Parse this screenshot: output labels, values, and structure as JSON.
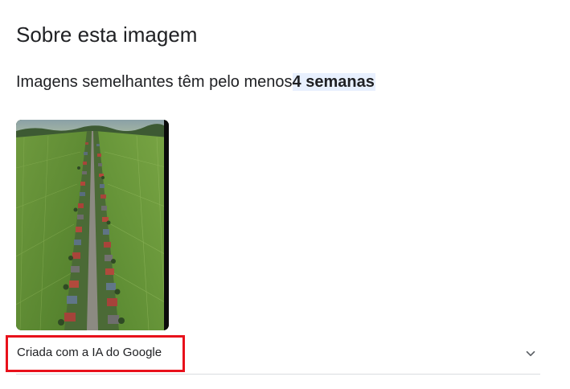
{
  "section": {
    "title": "Sobre esta imagem",
    "age_prefix": "Imagens semelhantes têm pelo menos",
    "age_value": "4 semanas"
  },
  "image": {
    "alt": "Vista aérea de uma estrada reta ladeada por casas entre campos verdes"
  },
  "ai_disclosure": {
    "label": "Criada com a IA do Google",
    "icon": "chevron-down-icon"
  },
  "colors": {
    "text": "#202124",
    "highlight_bg": "#e8f0fe",
    "annotation_red": "#e8111b",
    "divider": "#dadce0"
  }
}
